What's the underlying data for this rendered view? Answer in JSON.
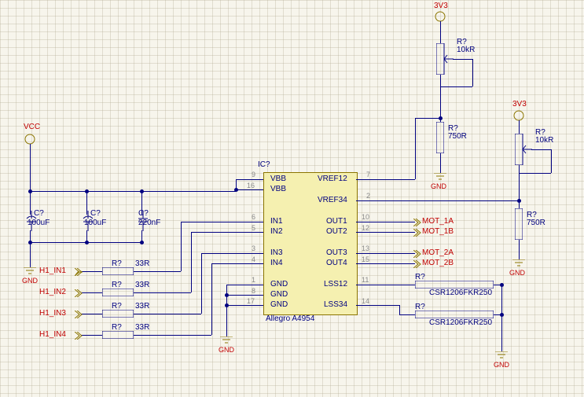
{
  "power": {
    "vcc": "VCC",
    "v3v3_a": "3V3",
    "v3v3_b": "3V3",
    "gnd": "GND"
  },
  "ic": {
    "ref": "IC?",
    "part": "Allegro A4954",
    "pins_left": [
      {
        "num": "9",
        "name": "VBB"
      },
      {
        "num": "16",
        "name": "VBB"
      },
      {
        "num": "6",
        "name": "IN1"
      },
      {
        "num": "5",
        "name": "IN2"
      },
      {
        "num": "3",
        "name": "IN3"
      },
      {
        "num": "4",
        "name": "IN4"
      },
      {
        "num": "1",
        "name": "GND"
      },
      {
        "num": "8",
        "name": "GND"
      },
      {
        "num": "17",
        "name": "GND"
      }
    ],
    "pins_right": [
      {
        "num": "7",
        "name": "VREF12"
      },
      {
        "num": "2",
        "name": "VREF34"
      },
      {
        "num": "10",
        "name": "OUT1"
      },
      {
        "num": "12",
        "name": "OUT2"
      },
      {
        "num": "13",
        "name": "OUT3"
      },
      {
        "num": "15",
        "name": "OUT4"
      },
      {
        "num": "11",
        "name": "LSS12"
      },
      {
        "num": "14",
        "name": "LSS34"
      }
    ]
  },
  "caps": {
    "c1": {
      "ref": "C?",
      "val": "100uF"
    },
    "c2": {
      "ref": "C?",
      "val": "100uF"
    },
    "c3": {
      "ref": "C?",
      "val": "220nF"
    }
  },
  "resistors": {
    "r_in1": {
      "ref": "R?",
      "val": "33R"
    },
    "r_in2": {
      "ref": "R?",
      "val": "33R"
    },
    "r_in3": {
      "ref": "R?",
      "val": "33R"
    },
    "r_in4": {
      "ref": "R?",
      "val": "33R"
    },
    "rpot_a": {
      "ref": "R?",
      "val": "10kR"
    },
    "rpot_b": {
      "ref": "R?",
      "val": "10kR"
    },
    "r_div_a": {
      "ref": "R?",
      "val": "750R"
    },
    "r_div_b": {
      "ref": "R?",
      "val": "750R"
    },
    "r_sense_a": {
      "ref": "R?",
      "val": "CSR1206FKR250"
    },
    "r_sense_b": {
      "ref": "R?",
      "val": "CSR1206FKR250"
    }
  },
  "ports": {
    "in1": "H1_IN1",
    "in2": "H1_IN2",
    "in3": "H1_IN3",
    "in4": "H1_IN4",
    "out1": "MOT_1A",
    "out2": "MOT_1B",
    "out3": "MOT_2A",
    "out4": "MOT_2B"
  }
}
